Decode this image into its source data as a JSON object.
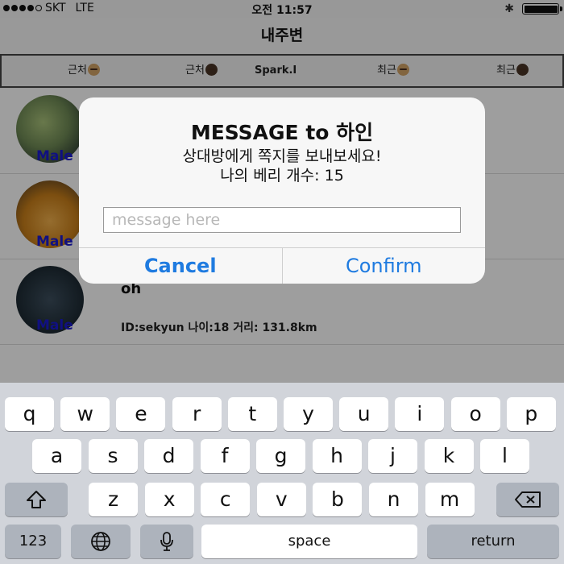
{
  "status_bar": {
    "carrier": "SKT",
    "network": "LTE",
    "time": "오전 11:57",
    "bluetooth_icon": "bluetooth-icon",
    "battery_level": 1.0
  },
  "nav": {
    "title": "내주변"
  },
  "tabs": [
    {
      "label": "근처",
      "emoji": "boy-emoji-icon",
      "bold": false
    },
    {
      "label": "근처",
      "emoji": "girl-emoji-icon",
      "bold": false
    },
    {
      "label": "Spark.I",
      "emoji": "",
      "bold": true
    },
    {
      "label": "최근",
      "emoji": "boy-emoji-icon",
      "bold": false
    },
    {
      "label": "최근",
      "emoji": "girl-emoji-icon",
      "bold": false
    }
  ],
  "users": [
    {
      "gender": "Male",
      "name": "",
      "info": ""
    },
    {
      "gender": "Male",
      "name": "",
      "info": ""
    },
    {
      "gender": "Male",
      "name": "oh",
      "info": "ID:sekyun 나이:18 거리: 131.8km"
    }
  ],
  "dialog": {
    "title": "MESSAGE to 하인",
    "subtitle": "상대방에게 쪽지를 보내보세요!",
    "berry_count": "나의 베리 개수: 15",
    "input_placeholder": "message here",
    "input_value": "",
    "cancel_label": "Cancel",
    "confirm_label": "Confirm"
  },
  "keyboard": {
    "row1": [
      "q",
      "w",
      "e",
      "r",
      "t",
      "y",
      "u",
      "i",
      "o",
      "p"
    ],
    "row2": [
      "a",
      "s",
      "d",
      "f",
      "g",
      "h",
      "j",
      "k",
      "l"
    ],
    "row3": [
      "z",
      "x",
      "c",
      "v",
      "b",
      "n",
      "m"
    ],
    "numbers_label": "123",
    "space_label": "space",
    "return_label": "return",
    "shift_icon": "shift-icon",
    "delete_icon": "backspace-icon",
    "globe_icon": "globe-icon",
    "mic_icon": "microphone-icon"
  },
  "colors": {
    "accent": "#1f7be0",
    "gender": "#1a1ad0"
  }
}
